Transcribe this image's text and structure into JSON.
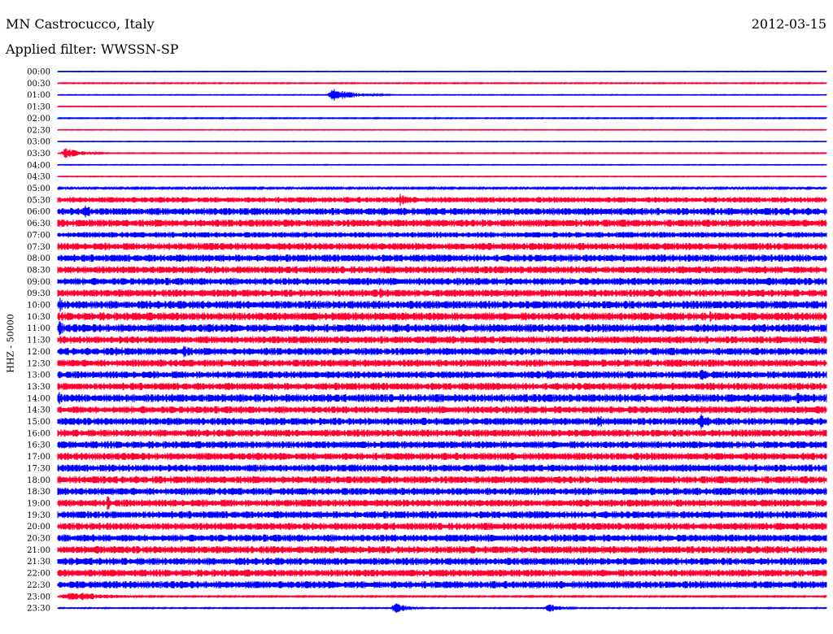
{
  "header": {
    "station": "MN Castrocucco, Italy",
    "date": "2012-03-15",
    "filter": "Applied filter: WWSSN-SP"
  },
  "chart_data": {
    "type": "line",
    "title": "MN Castrocucco, Italy",
    "subtitle": "Applied filter: WWSSN-SP",
    "ylabel": "HHZ - 50000",
    "xlabel": "",
    "colors": [
      "#0000ff",
      "#ff0033"
    ],
    "grid": false,
    "legend": "none",
    "rows": [
      "00:00",
      "00:30",
      "01:00",
      "01:30",
      "02:00",
      "02:30",
      "03:00",
      "03:30",
      "04:00",
      "04:30",
      "05:00",
      "05:30",
      "06:00",
      "06:30",
      "07:00",
      "07:30",
      "08:00",
      "08:30",
      "09:00",
      "09:30",
      "10:00",
      "10:30",
      "11:00",
      "11:30",
      "12:00",
      "12:30",
      "13:00",
      "13:30",
      "14:00",
      "14:30",
      "15:00",
      "16:00",
      "16:30",
      "17:00",
      "17:30",
      "18:00",
      "18:30",
      "19:00",
      "19:30",
      "20:00",
      "20:30",
      "21:00",
      "21:30",
      "22:00",
      "22:30",
      "23:00",
      "23:30"
    ],
    "noise_level": [
      0.3,
      0.6,
      0.4,
      0.4,
      0.6,
      0.4,
      0.3,
      0.5,
      0.4,
      0.4,
      1.2,
      3.5,
      4.5,
      4.5,
      3.5,
      4.5,
      4.5,
      4.5,
      4.5,
      4.5,
      5,
      5,
      5,
      4.5,
      4.5,
      4.5,
      4.5,
      4.5,
      5,
      4.5,
      4.5,
      4.5,
      4.5,
      4.5,
      4.5,
      4.5,
      4.5,
      4.5,
      4.5,
      4.5,
      4.5,
      4.5,
      4.5,
      4.5,
      4.5,
      0.8,
      0.6
    ],
    "events": [
      {
        "row": "01:00",
        "start_min": 10.5,
        "duration_min": 2.5,
        "level": 8
      },
      {
        "row": "03:30",
        "start_min": 0.1,
        "duration_min": 2.0,
        "level": 7
      },
      {
        "row": "05:30",
        "start_min": 13.2,
        "duration_min": 1.5,
        "level": 8
      },
      {
        "row": "06:00",
        "start_min": 1.0,
        "duration_min": 0.8,
        "level": 10
      },
      {
        "row": "09:30",
        "start_min": 12.5,
        "duration_min": 1.0,
        "level": 9
      },
      {
        "row": "10:00",
        "start_min": 0.0,
        "duration_min": 0.8,
        "level": 10
      },
      {
        "row": "10:30",
        "start_min": 25.4,
        "duration_min": 0.6,
        "level": 10
      },
      {
        "row": "11:00",
        "start_min": 0.0,
        "duration_min": 0.6,
        "level": 12
      },
      {
        "row": "12:00",
        "start_min": 2.2,
        "duration_min": 1.2,
        "level": 8
      },
      {
        "row": "12:00",
        "start_min": 4.8,
        "duration_min": 1.2,
        "level": 9
      },
      {
        "row": "13:00",
        "start_min": 19.0,
        "duration_min": 1.0,
        "level": 9
      },
      {
        "row": "13:00",
        "start_min": 25.0,
        "duration_min": 1.0,
        "level": 9
      },
      {
        "row": "14:00",
        "start_min": 0.0,
        "duration_min": 0.5,
        "level": 9
      },
      {
        "row": "14:00",
        "start_min": 28.8,
        "duration_min": 0.6,
        "level": 10
      },
      {
        "row": "15:00",
        "start_min": 21.0,
        "duration_min": 1.0,
        "level": 9
      },
      {
        "row": "15:00",
        "start_min": 25.0,
        "duration_min": 1.2,
        "level": 10
      },
      {
        "row": "19:00",
        "start_min": 1.9,
        "duration_min": 0.4,
        "level": 11
      },
      {
        "row": "23:00",
        "start_min": 0.0,
        "duration_min": 5.0,
        "level": 6
      },
      {
        "row": "23:30",
        "start_min": 13.0,
        "duration_min": 1.5,
        "level": 7
      },
      {
        "row": "23:30",
        "start_min": 19.0,
        "duration_min": 1.5,
        "level": 6
      }
    ],
    "xlim": [
      0,
      30
    ],
    "trace_spacing": 14.35
  }
}
